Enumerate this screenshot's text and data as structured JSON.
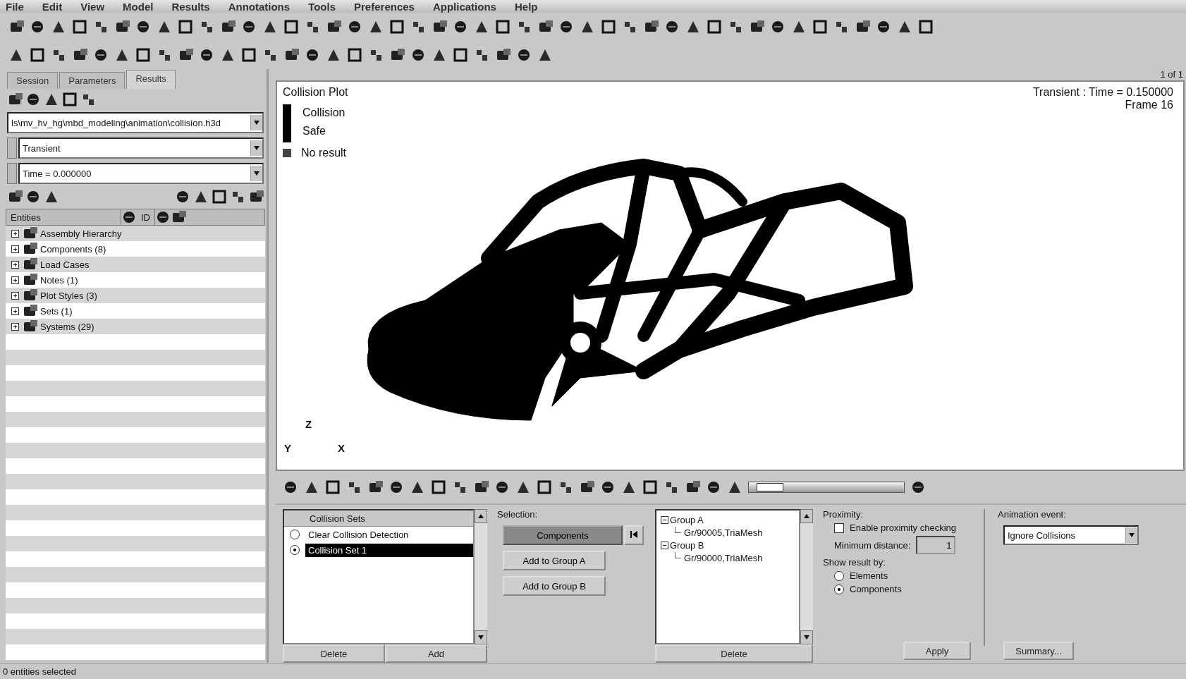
{
  "menu": [
    "File",
    "Edit",
    "View",
    "Model",
    "Results",
    "Annotations",
    "Tools",
    "Preferences",
    "Applications",
    "Help"
  ],
  "left_panel": {
    "tabs": [
      {
        "label": "Session",
        "selected": false
      },
      {
        "label": "Parameters",
        "selected": false
      },
      {
        "label": "Results",
        "selected": true
      }
    ],
    "file_field": "ls\\mv_hv_hg\\mbd_modeling\\animation\\collision.h3d",
    "result_type": "Transient",
    "time_step": "Time = 0.000000",
    "columns": [
      "Entities",
      "ID"
    ],
    "tree": [
      {
        "label": "Assembly Hierarchy",
        "expanded": false
      },
      {
        "label": "Components (8)",
        "expanded": false
      },
      {
        "label": "Load Cases",
        "expanded": false
      },
      {
        "label": "Notes (1)",
        "expanded": false
      },
      {
        "label": "Plot Styles (3)",
        "expanded": false
      },
      {
        "label": "Sets  (1)",
        "expanded": false
      },
      {
        "label": "Systems (29)",
        "expanded": false
      }
    ]
  },
  "viewport": {
    "page_indicator": "1 of 1",
    "title": "Collision Plot",
    "legend": [
      {
        "label": "Collision"
      },
      {
        "label": "Safe"
      }
    ],
    "no_result": "No result",
    "info": [
      "Transient : Time = 0.150000",
      "Frame 16"
    ],
    "axes": [
      "Z",
      "Y",
      "X"
    ]
  },
  "animation": {
    "level": 0.06
  },
  "collision_sets": {
    "header": "Collision Sets",
    "rows": [
      {
        "label": "Clear Collision Detection",
        "selected": false
      },
      {
        "label": "Collision Set 1",
        "selected": true
      }
    ],
    "buttons": [
      "Delete",
      "Add"
    ]
  },
  "selection": {
    "label": "Selection:",
    "mode": "Components",
    "buttons": [
      "Add to Group A",
      "Add to Group B"
    ]
  },
  "groups": {
    "tree": [
      {
        "label": "Group A",
        "expanded": true,
        "children": [
          {
            "label": "Gr/90005,TriaMesh"
          }
        ]
      },
      {
        "label": "Group B",
        "expanded": true,
        "children": [
          {
            "label": "Gr/90000,TriaMesh"
          }
        ]
      }
    ],
    "button": "Delete"
  },
  "proximity": {
    "label": "Proximity:",
    "checkbox": {
      "label": "Enable proximity checking",
      "checked": false
    },
    "distance_label": "Minimum distance:",
    "distance": "1",
    "show_label": "Show result by:",
    "options": [
      {
        "label": "Elements",
        "selected": false
      },
      {
        "label": "Components",
        "selected": true
      }
    ],
    "button": "Apply"
  },
  "animation_event": {
    "label": "Animation event:",
    "value": "Ignore Collisions",
    "button": "Summary..."
  },
  "status_bar": "0 entities selected"
}
